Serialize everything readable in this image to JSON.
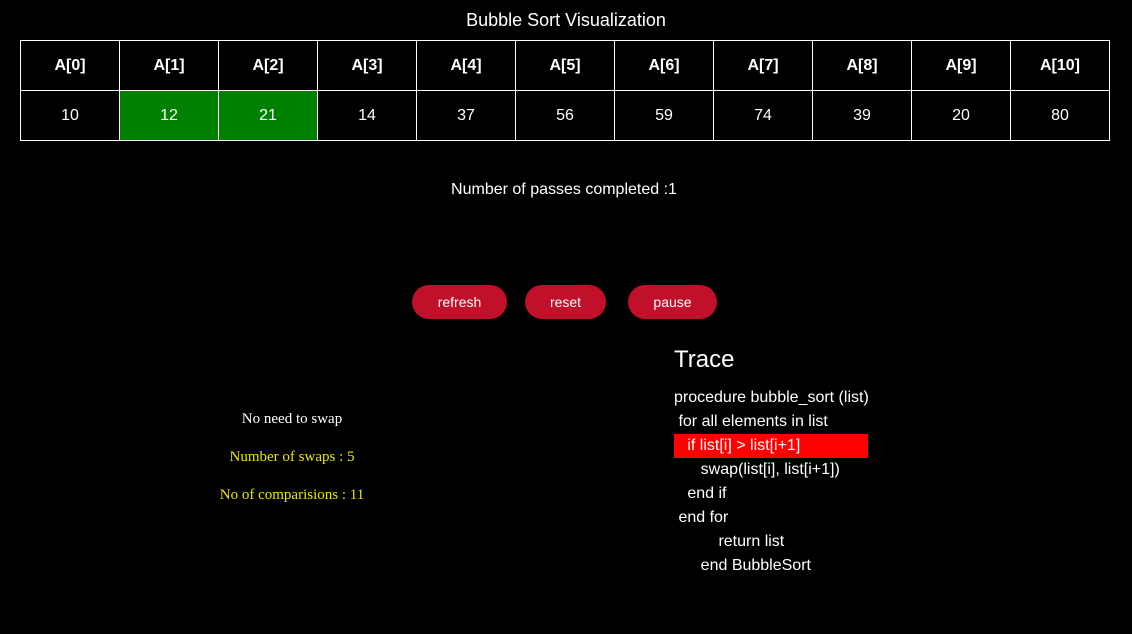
{
  "title": "Bubble Sort Visualization",
  "array": {
    "headers": [
      "A[0]",
      "A[1]",
      "A[2]",
      "A[3]",
      "A[4]",
      "A[5]",
      "A[6]",
      "A[7]",
      "A[8]",
      "A[9]",
      "A[10]"
    ],
    "values": [
      "10",
      "12",
      "21",
      "14",
      "37",
      "56",
      "59",
      "74",
      "39",
      "20",
      "80"
    ],
    "highlight_color": "#008000"
  },
  "passes_text": "Number of passes completed :1",
  "buttons": {
    "refresh": "refresh",
    "reset": "reset",
    "pause": "pause",
    "color": "#c0102a"
  },
  "status": {
    "message": "No need to swap",
    "swaps": "Number of swaps : 5",
    "comparisons": "No of comparisions : 11"
  },
  "trace": {
    "title": "Trace",
    "lines": [
      "procedure bubble_sort (list)",
      " for all elements in list",
      "   if list[i] > list[i+1]",
      "      swap(list[i], list[i+1])",
      "   end if",
      " end for",
      "          return list",
      "      end BubbleSort"
    ],
    "active_color": "#ff0000"
  }
}
